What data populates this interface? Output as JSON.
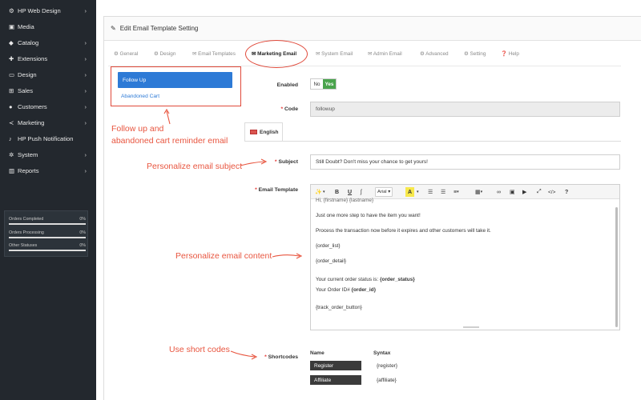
{
  "sidebar": {
    "items": [
      {
        "icon": "gears-icon",
        "glyph": "⚙",
        "label": "HP Web Design",
        "chev": true
      },
      {
        "icon": "image-icon",
        "glyph": "▣",
        "label": "Media",
        "chev": false
      },
      {
        "icon": "tag-icon",
        "glyph": "◆",
        "label": "Catalog",
        "chev": true
      },
      {
        "icon": "puzzle-icon",
        "glyph": "✚",
        "label": "Extensions",
        "chev": true
      },
      {
        "icon": "monitor-icon",
        "glyph": "▭",
        "label": "Design",
        "chev": true
      },
      {
        "icon": "cart-icon",
        "glyph": "⊞",
        "label": "Sales",
        "chev": true
      },
      {
        "icon": "user-icon",
        "glyph": "●",
        "label": "Customers",
        "chev": true
      },
      {
        "icon": "share-icon",
        "glyph": "≺",
        "label": "Marketing",
        "chev": true
      },
      {
        "icon": "bell-icon",
        "glyph": "♪",
        "label": "HP Push Notification",
        "chev": false
      },
      {
        "icon": "cog-icon",
        "glyph": "✲",
        "label": "System",
        "chev": true
      },
      {
        "icon": "bar-chart-icon",
        "glyph": "▥",
        "label": "Reports",
        "chev": true
      }
    ],
    "stats": [
      {
        "label": "Orders Completed",
        "value": "0%"
      },
      {
        "label": "Orders Processing",
        "value": "0%"
      },
      {
        "label": "Other Statuses",
        "value": "0%"
      }
    ]
  },
  "panel": {
    "title": "Edit Email Template Setting"
  },
  "tabs": [
    {
      "label": "General",
      "glyph": "⚙"
    },
    {
      "label": "Design",
      "glyph": "⚙"
    },
    {
      "label": "Email Templates",
      "glyph": "✉"
    },
    {
      "label": "Marketing Email",
      "glyph": "✉"
    },
    {
      "label": "System Email",
      "glyph": "✉"
    },
    {
      "label": "Admin Email",
      "glyph": "✉"
    },
    {
      "label": "Advanced",
      "glyph": "⚙"
    },
    {
      "label": "Setting",
      "glyph": "⚙"
    },
    {
      "label": "Help",
      "glyph": "❓"
    }
  ],
  "list": {
    "follow_up": "Follow Up",
    "abandoned_cart": "Abandoned Cart"
  },
  "form": {
    "enabled_label": "Enabled",
    "toggle_no": "No",
    "toggle_yes": "Yes",
    "code_label": "Code",
    "code_value": "followup",
    "language_tab": "English",
    "subject_label": "Subject",
    "subject_value": "Still Doubt? Don't miss your chance to get yours!",
    "template_label": "Email Template",
    "shortcodes_label": "Shortcodes",
    "required_mark": "*"
  },
  "editor": {
    "toolbar": {
      "magic": "✨",
      "bold": "B",
      "underline": "U",
      "eraser": "ʃ",
      "font": "Arial",
      "color": "A",
      "ul": "☰",
      "ol": "☰",
      "align": "≡",
      "table": "▦",
      "link": "∞",
      "picture": "▣",
      "video": "▶",
      "fullscreen": "⤢",
      "code": "</>",
      "help": "?"
    },
    "lines": [
      "Hi, {firstname} {lastname}",
      "Just one more step to have the item you want!",
      "Process the transaction now before it expires and other customers will take it.",
      "{order_list}",
      "{order_detail}",
      "Your current order status is:",
      "Your Order ID#"
    ],
    "bold_status": "{order_status}",
    "bold_id": "{order_id}",
    "track": "{track_order_button}"
  },
  "shortcodes": {
    "col_name": "Name",
    "col_syntax": "Syntax",
    "rows": [
      {
        "name": "Register",
        "syntax": "{register}"
      },
      {
        "name": "Affiliate",
        "syntax": "{affiliate}"
      }
    ]
  },
  "annotations": {
    "follow_up": "Follow up and",
    "follow_up_2": "abandoned cart reminder email",
    "subject": "Personalize email subject",
    "content": "Personalize email content",
    "shortcodes": "Use short codes"
  },
  "colors": {
    "sidebar_bg": "#23282e",
    "accent_blue": "#2d7ad6",
    "annotation_red": "#e8553f",
    "toggle_green": "#49a34c"
  }
}
